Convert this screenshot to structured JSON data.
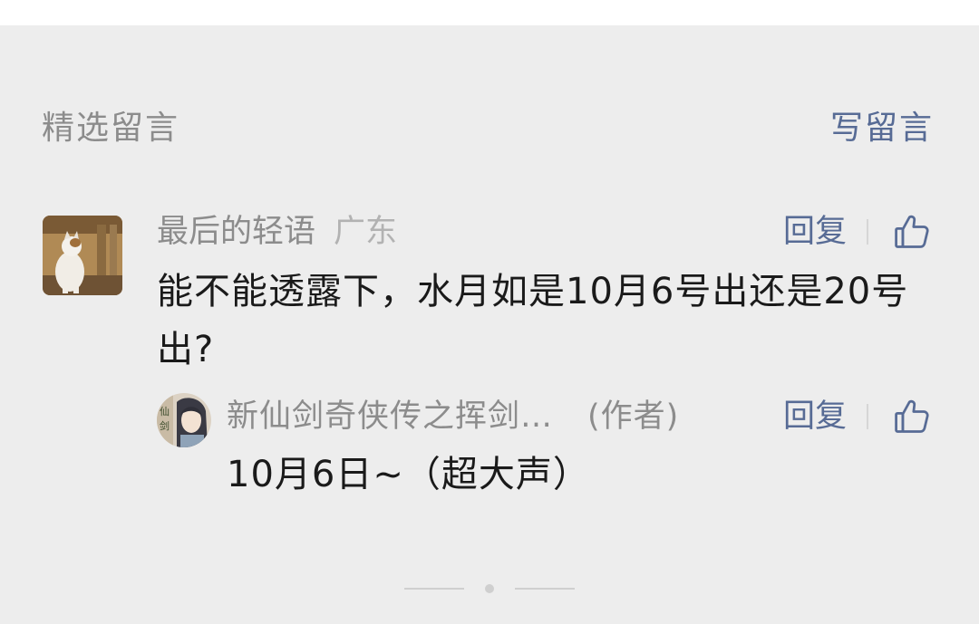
{
  "section": {
    "title": "精选留言",
    "write_label": "写留言"
  },
  "comment": {
    "nickname": "最后的轻语",
    "location": "广东",
    "reply_label": "回复",
    "text": "能不能透露下，水月如是10月6号出还是20号出?"
  },
  "author_reply": {
    "name": "新仙剑奇侠传之挥剑…",
    "author_tag": "(作者)",
    "reply_label": "回复",
    "text": "10月6日~（超大声）",
    "avatar_text": "仙剑"
  },
  "icons": {
    "like": "thumbs-up-icon"
  },
  "colors": {
    "background": "#ededed",
    "link": "#576b95",
    "secondary_text": "#8c8c8c",
    "primary_text": "#1a1a1a"
  }
}
